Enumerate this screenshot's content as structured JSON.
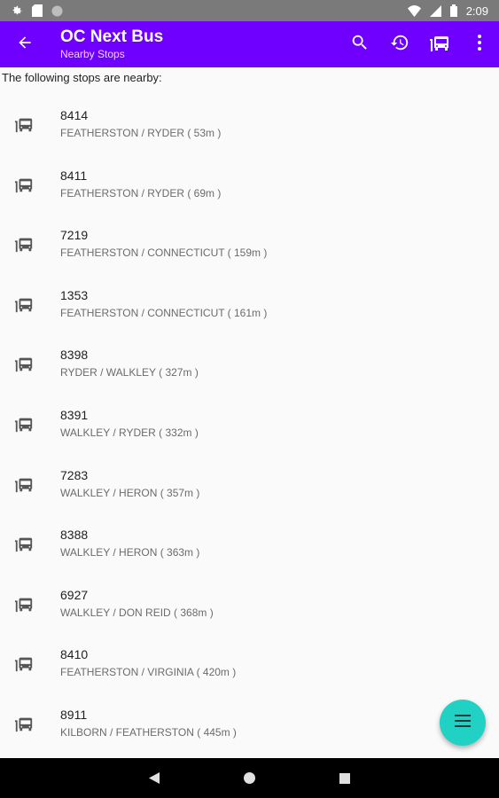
{
  "status_bar": {
    "time": "2:09"
  },
  "app_bar": {
    "title": "OC Next Bus",
    "subtitle": "Nearby Stops"
  },
  "intro_text": "The following stops are nearby:",
  "stops": [
    {
      "number": "8414",
      "desc": "FEATHERSTON / RYDER ( 53m )"
    },
    {
      "number": "8411",
      "desc": "FEATHERSTON / RYDER ( 69m )"
    },
    {
      "number": "7219",
      "desc": "FEATHERSTON / CONNECTICUT ( 159m )"
    },
    {
      "number": "1353",
      "desc": "FEATHERSTON / CONNECTICUT ( 161m )"
    },
    {
      "number": "8398",
      "desc": "RYDER / WALKLEY ( 327m )"
    },
    {
      "number": "8391",
      "desc": "WALKLEY / RYDER ( 332m )"
    },
    {
      "number": "7283",
      "desc": "WALKLEY / HERON ( 357m )"
    },
    {
      "number": "8388",
      "desc": "WALKLEY / HERON ( 363m )"
    },
    {
      "number": "6927",
      "desc": "WALKLEY / DON REID ( 368m )"
    },
    {
      "number": "8410",
      "desc": "FEATHERSTON / VIRGINIA ( 420m )"
    },
    {
      "number": "8911",
      "desc": "KILBORN / FEATHERSTON ( 445m )"
    }
  ],
  "colors": {
    "app_bar": "#6f00ff",
    "fab": "#21d1c4",
    "status_bar": "#7a7a7a"
  },
  "icons": {
    "back": "arrow-back-icon",
    "search": "search-icon",
    "history": "history-icon",
    "stops": "bus-stop-icon",
    "overflow": "more-vert-icon",
    "fab": "menu-icon"
  }
}
